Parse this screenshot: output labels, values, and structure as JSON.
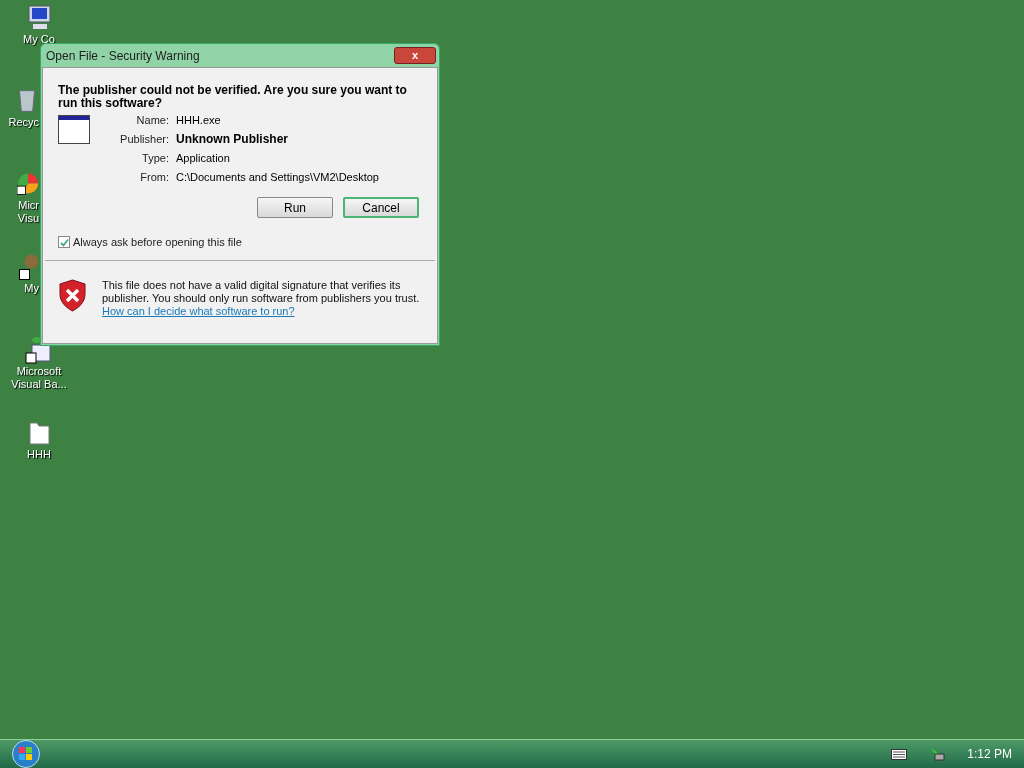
{
  "desktop_icons": [
    {
      "kind": "computer",
      "lines": [
        "My Co"
      ]
    },
    {
      "kind": "recycle",
      "lines": [
        "Recyc"
      ]
    },
    {
      "kind": "chart",
      "lines": [
        "Micr",
        "Visu"
      ]
    },
    {
      "kind": "tools",
      "lines": [
        "My"
      ]
    },
    {
      "kind": "vb",
      "lines": [
        "Microsoft",
        "Visual Ba..."
      ]
    },
    {
      "kind": "file",
      "lines": [
        "HHH"
      ]
    }
  ],
  "dialog": {
    "title": "Open File - Security Warning",
    "close": "x",
    "question": "The publisher could not be verified.  Are you sure you want to run this software?",
    "fields": [
      {
        "label": "Name:",
        "value": "HHH.exe",
        "bold": false
      },
      {
        "label": "Publisher:",
        "value": "Unknown Publisher",
        "bold": true
      },
      {
        "label": "Type:",
        "value": "Application",
        "bold": false
      },
      {
        "label": "From:",
        "value": "C:\\Documents and Settings\\VM2\\Desktop",
        "bold": false
      }
    ],
    "buttons": [
      {
        "label": "Run",
        "selected": false
      },
      {
        "label": "Cancel",
        "selected": true
      }
    ],
    "checkbox": {
      "label": "Always ask before opening this file",
      "checked": true
    },
    "warning": "This file does not have a valid digital signature that verifies its publisher.  You should only run software from publishers you trust.",
    "help_link": "How can I decide what software to run?"
  },
  "taskbar": {
    "clock": "1:12 PM"
  }
}
